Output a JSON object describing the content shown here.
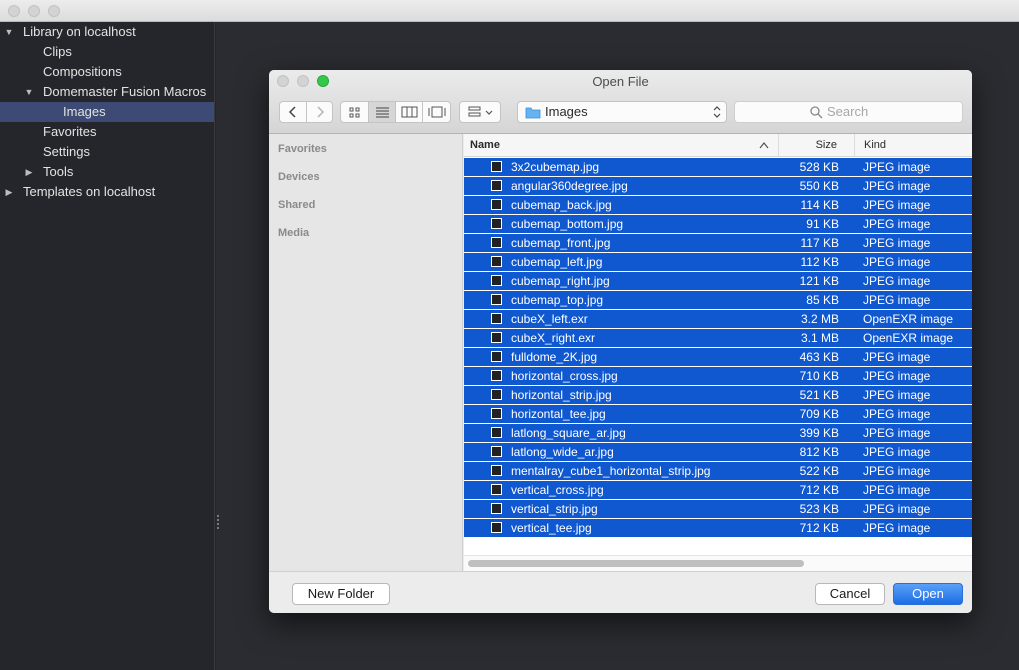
{
  "host": {
    "tree": [
      {
        "label": "Library on localhost",
        "expanded": true,
        "level": 0
      },
      {
        "label": "Clips",
        "level": 1
      },
      {
        "label": "Compositions",
        "level": 1
      },
      {
        "label": "Domemaster Fusion Macros",
        "expanded": true,
        "level": 1
      },
      {
        "label": "Images",
        "level": 2,
        "selected": true
      },
      {
        "label": "Favorites",
        "level": 1
      },
      {
        "label": "Settings",
        "level": 1
      },
      {
        "label": "Tools",
        "expanded": false,
        "level": 1
      },
      {
        "label": "Templates on localhost",
        "expanded": false,
        "level": 0
      }
    ]
  },
  "dialog": {
    "title": "Open File",
    "path": "Images",
    "search_placeholder": "Search",
    "sidebar_sections": [
      "Favorites",
      "Devices",
      "Shared",
      "Media"
    ],
    "columns": {
      "name": "Name",
      "size": "Size",
      "kind": "Kind"
    },
    "files": [
      {
        "name": "3x2cubemap.jpg",
        "size": "528 KB",
        "kind": "JPEG image"
      },
      {
        "name": "angular360degree.jpg",
        "size": "550 KB",
        "kind": "JPEG image"
      },
      {
        "name": "cubemap_back.jpg",
        "size": "114 KB",
        "kind": "JPEG image"
      },
      {
        "name": "cubemap_bottom.jpg",
        "size": "91 KB",
        "kind": "JPEG image"
      },
      {
        "name": "cubemap_front.jpg",
        "size": "117 KB",
        "kind": "JPEG image"
      },
      {
        "name": "cubemap_left.jpg",
        "size": "112 KB",
        "kind": "JPEG image"
      },
      {
        "name": "cubemap_right.jpg",
        "size": "121 KB",
        "kind": "JPEG image"
      },
      {
        "name": "cubemap_top.jpg",
        "size": "85 KB",
        "kind": "JPEG image"
      },
      {
        "name": "cubeX_left.exr",
        "size": "3.2 MB",
        "kind": "OpenEXR image"
      },
      {
        "name": "cubeX_right.exr",
        "size": "3.1 MB",
        "kind": "OpenEXR image"
      },
      {
        "name": "fulldome_2K.jpg",
        "size": "463 KB",
        "kind": "JPEG image"
      },
      {
        "name": "horizontal_cross.jpg",
        "size": "710 KB",
        "kind": "JPEG image"
      },
      {
        "name": "horizontal_strip.jpg",
        "size": "521 KB",
        "kind": "JPEG image"
      },
      {
        "name": "horizontal_tee.jpg",
        "size": "709 KB",
        "kind": "JPEG image"
      },
      {
        "name": "latlong_square_ar.jpg",
        "size": "399 KB",
        "kind": "JPEG image"
      },
      {
        "name": "latlong_wide_ar.jpg",
        "size": "812 KB",
        "kind": "JPEG image"
      },
      {
        "name": "mentalray_cube1_horizontal_strip.jpg",
        "size": "522 KB",
        "kind": "JPEG image"
      },
      {
        "name": "vertical_cross.jpg",
        "size": "712 KB",
        "kind": "JPEG image"
      },
      {
        "name": "vertical_strip.jpg",
        "size": "523 KB",
        "kind": "JPEG image"
      },
      {
        "name": "vertical_tee.jpg",
        "size": "712 KB",
        "kind": "JPEG image"
      }
    ],
    "buttons": {
      "new_folder": "New Folder",
      "cancel": "Cancel",
      "open": "Open"
    }
  },
  "colors": {
    "selection": "#1058d0",
    "host_selection": "#3d4a73",
    "primary_button": "#1c6de5",
    "close": "#fc605c",
    "zoom": "#34c84a"
  }
}
